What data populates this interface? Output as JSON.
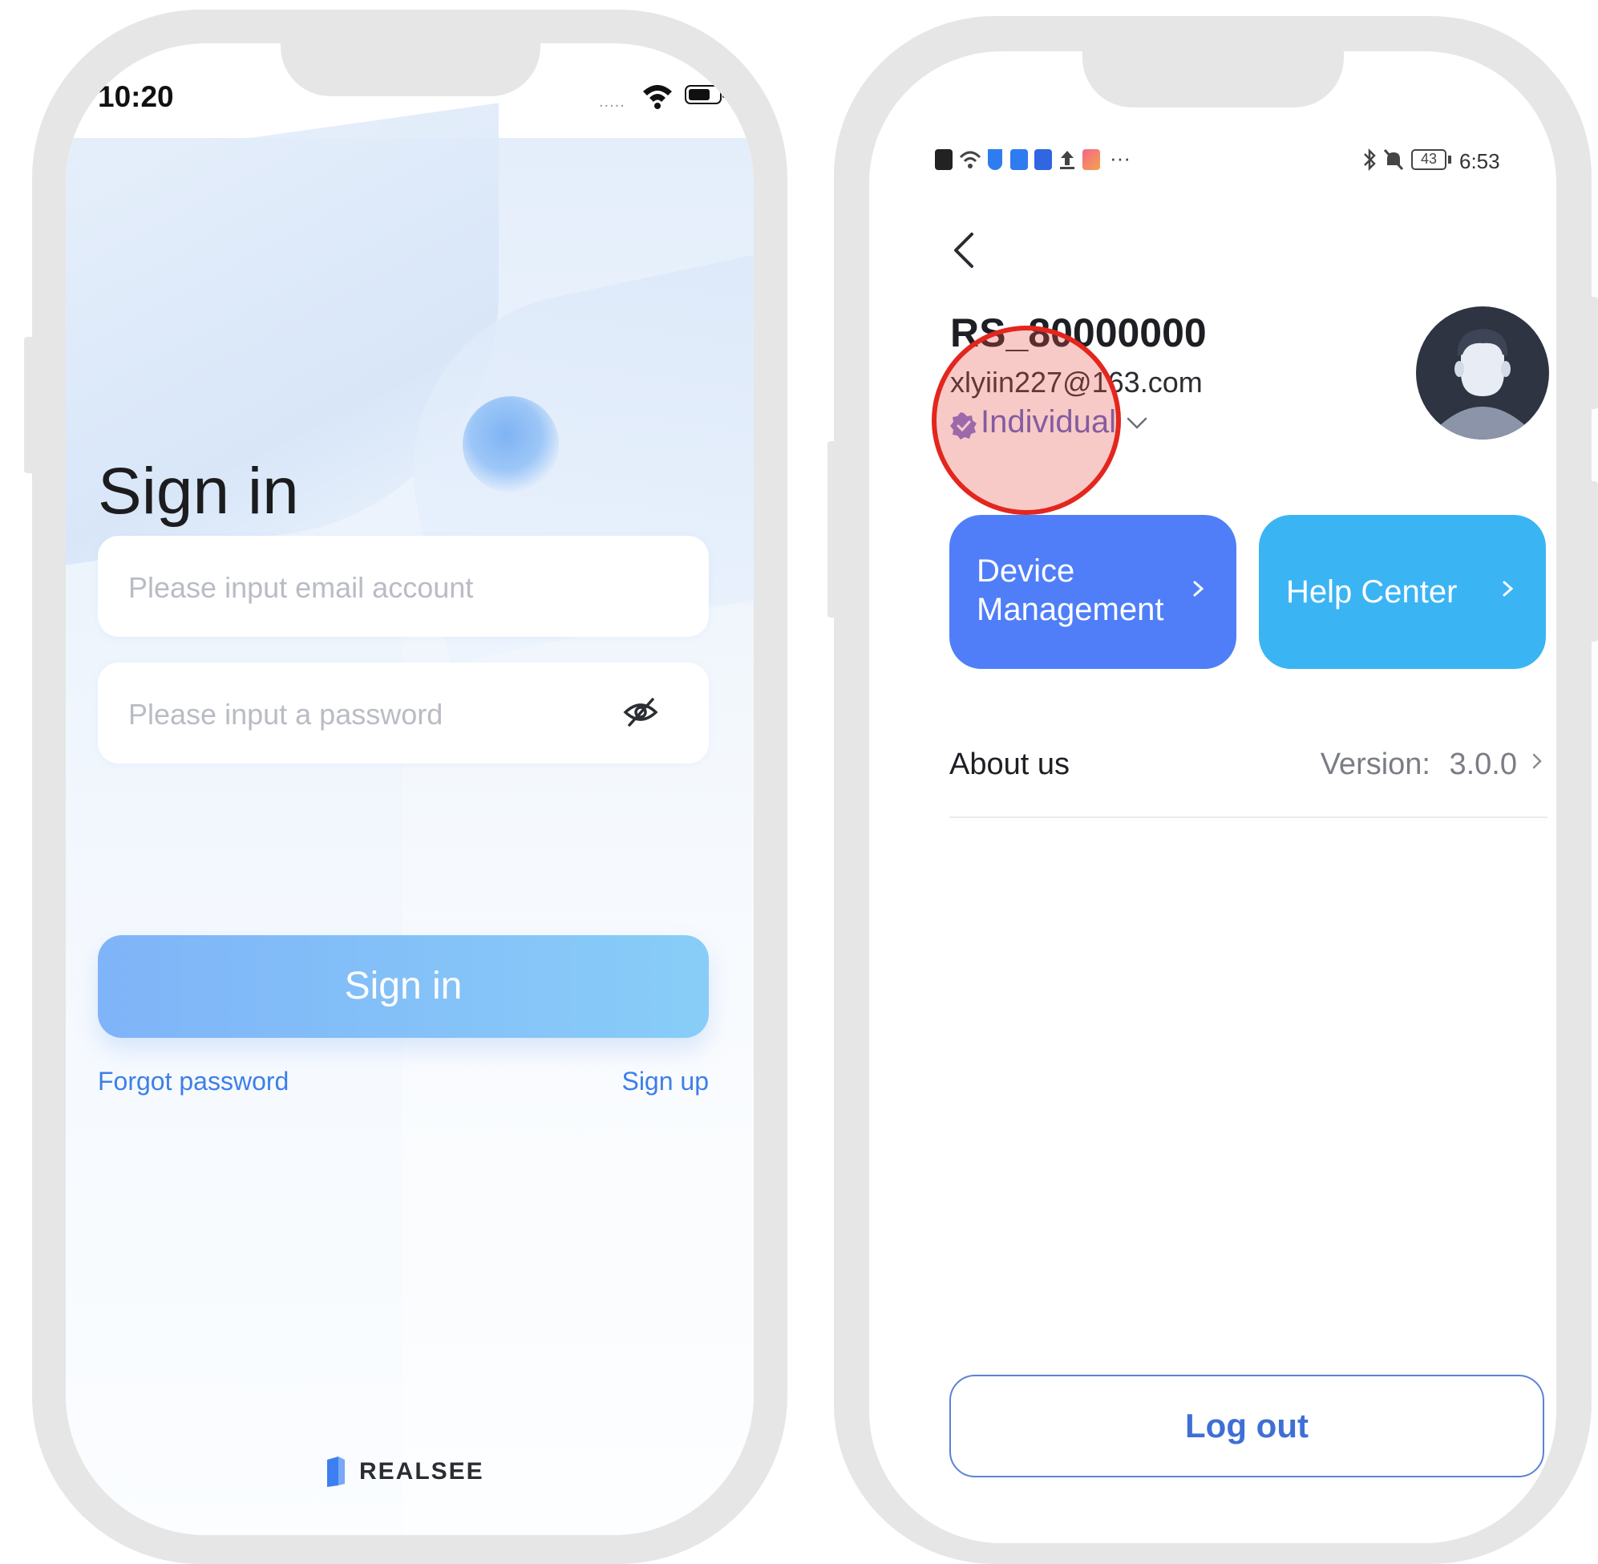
{
  "left_phone": {
    "status_bar": {
      "time": "10:20",
      "signal_dots": "....."
    },
    "title": "Sign in",
    "email_field": {
      "placeholder": "Please input email account"
    },
    "password_field": {
      "placeholder": "Please input a password"
    },
    "sign_in_button": "Sign in",
    "forgot_password": "Forgot password",
    "sign_up": "Sign up",
    "brand": "REALSEE"
  },
  "right_phone": {
    "status_bar": {
      "time": "6:53",
      "battery": "43",
      "more": "···"
    },
    "profile": {
      "name": "RS_80000000",
      "email": "xlyiin227@163.com",
      "role": "Individual"
    },
    "cards": [
      {
        "label_line1": "Device",
        "label_line2": "Management"
      },
      {
        "label": "Help Center"
      }
    ],
    "about": {
      "label": "About us",
      "version_label": "Version:",
      "version_value": "3.0.0"
    },
    "logout": "Log out"
  },
  "colors": {
    "accent_blue": "#4f7ef8",
    "help_blue": "#3bb4f4",
    "sign_in_gradient_start": "#7fb4f8",
    "sign_in_gradient_end": "#88cdf8",
    "link_blue": "#3d7fe8",
    "highlight_red": "#e3261e",
    "role_purple": "#5a62c8"
  },
  "icons": [
    "wifi-icon",
    "battery-icon",
    "eye-off-icon",
    "back-arrow-icon",
    "verified-badge-icon",
    "chevron-down-icon",
    "chevron-right-icon",
    "avatar-icon",
    "bluetooth-icon",
    "mute-icon",
    "realsee-logo-icon"
  ]
}
